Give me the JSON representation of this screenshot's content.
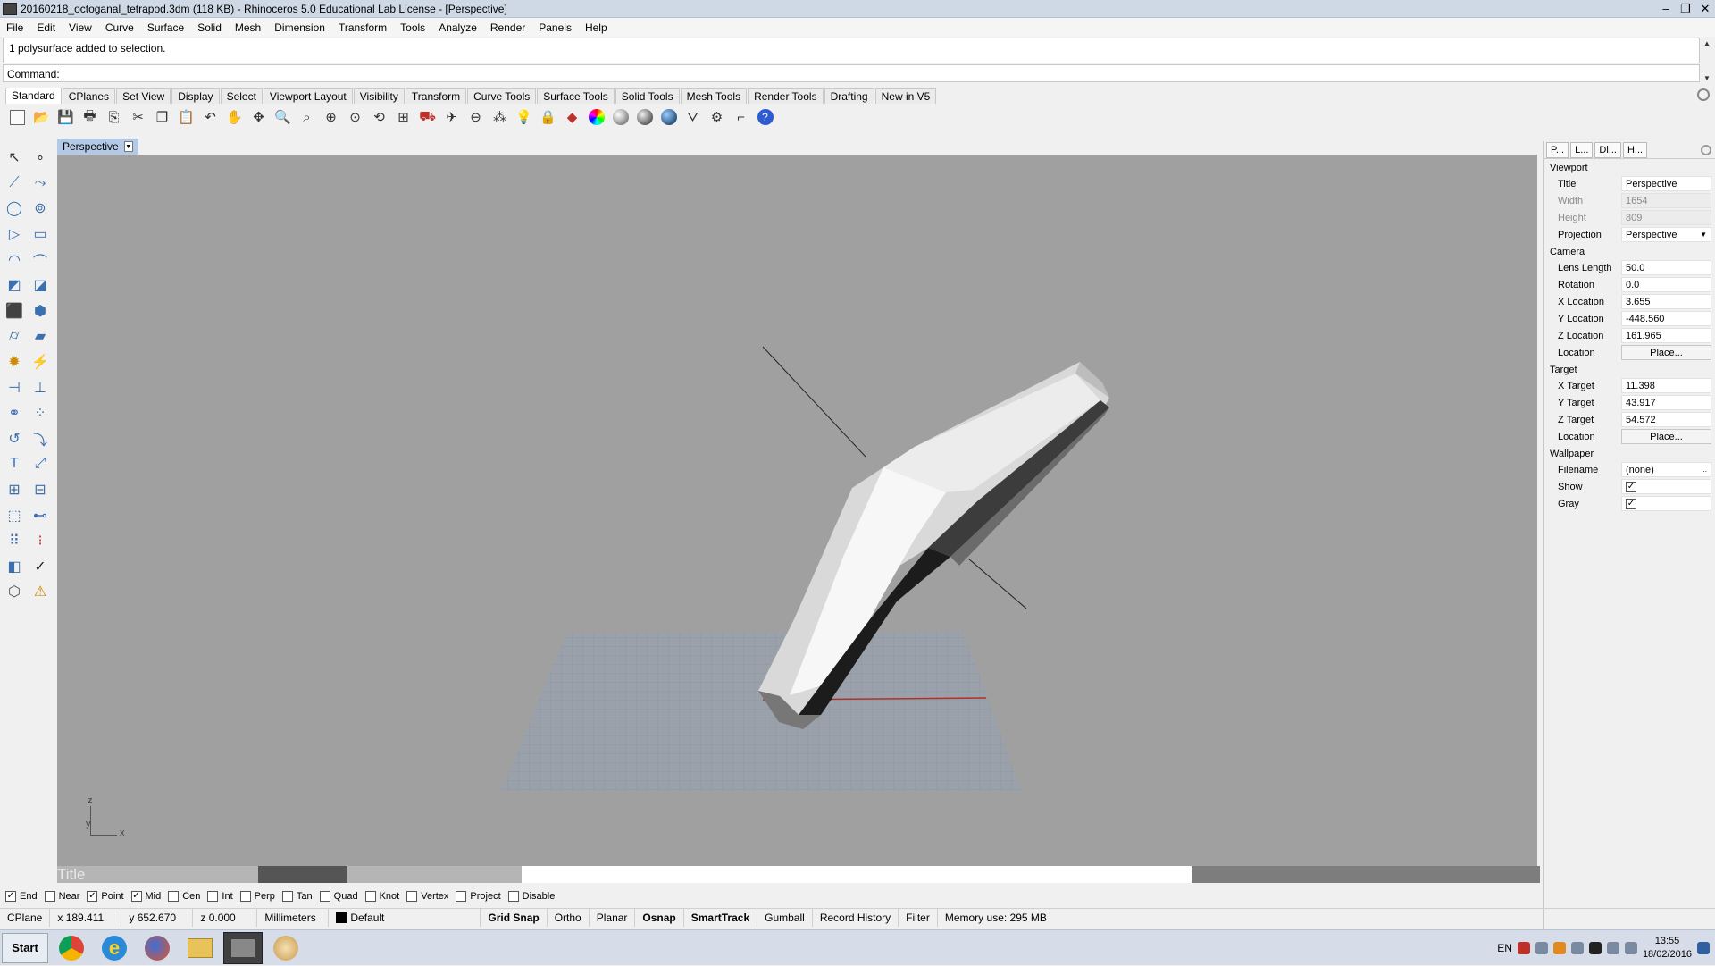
{
  "window": {
    "title": "20160218_octoganal_tetrapod.3dm (118 KB) - Rhinoceros 5.0 Educational Lab License - [Perspective]",
    "controls": [
      "–",
      "❐",
      "✕"
    ]
  },
  "menu": [
    "File",
    "Edit",
    "View",
    "Curve",
    "Surface",
    "Solid",
    "Mesh",
    "Dimension",
    "Transform",
    "Tools",
    "Analyze",
    "Render",
    "Panels",
    "Help"
  ],
  "command": {
    "history": "1 polysurface added to selection.",
    "prompt": "Command:"
  },
  "toolbar_tabs": [
    "Standard",
    "CPlanes",
    "Set View",
    "Display",
    "Select",
    "Viewport Layout",
    "Visibility",
    "Transform",
    "Curve Tools",
    "Surface Tools",
    "Solid Tools",
    "Mesh Tools",
    "Render Tools",
    "Drafting",
    "New in V5"
  ],
  "viewport": {
    "name": "Perspective",
    "axis_z": "z",
    "axis_y": "y",
    "axis_x": "x",
    "bottom_label": "Title"
  },
  "properties": {
    "tabs": [
      "P...",
      "L...",
      "Di...",
      "H..."
    ],
    "sections": {
      "viewport": "Viewport",
      "camera": "Camera",
      "target": "Target",
      "wallpaper": "Wallpaper"
    },
    "viewport_rows": {
      "title_k": "Title",
      "title_v": "Perspective",
      "width_k": "Width",
      "width_v": "1654",
      "height_k": "Height",
      "height_v": "809",
      "projection_k": "Projection",
      "projection_v": "Perspective"
    },
    "camera_rows": {
      "lens_k": "Lens Length",
      "lens_v": "50.0",
      "rot_k": "Rotation",
      "rot_v": "0.0",
      "xloc_k": "X Location",
      "xloc_v": "3.655",
      "yloc_k": "Y Location",
      "yloc_v": "-448.560",
      "zloc_k": "Z Location",
      "zloc_v": "161.965",
      "loc_k": "Location",
      "loc_v": "Place..."
    },
    "target_rows": {
      "xt_k": "X Target",
      "xt_v": "11.398",
      "yt_k": "Y Target",
      "yt_v": "43.917",
      "zt_k": "Z Target",
      "zt_v": "54.572",
      "loc_k": "Location",
      "loc_v": "Place..."
    },
    "wallpaper_rows": {
      "file_k": "Filename",
      "file_v": "(none)",
      "file_btn": "...",
      "show_k": "Show",
      "gray_k": "Gray"
    }
  },
  "osnap": {
    "end": "End",
    "near": "Near",
    "point": "Point",
    "mid": "Mid",
    "cen": "Cen",
    "int": "Int",
    "perp": "Perp",
    "tan": "Tan",
    "quad": "Quad",
    "knot": "Knot",
    "vertex": "Vertex",
    "project": "Project",
    "disable": "Disable"
  },
  "status": {
    "cplane": "CPlane",
    "x": "x 189.411",
    "y": "y 652.670",
    "z": "z 0.000",
    "units": "Millimeters",
    "layer": "Default",
    "grid_snap": "Grid Snap",
    "ortho": "Ortho",
    "planar": "Planar",
    "osnap": "Osnap",
    "smarttrack": "SmartTrack",
    "gumball": "Gumball",
    "record": "Record History",
    "filter": "Filter",
    "memory": "Memory use: 295 MB"
  },
  "taskbar": {
    "start": "Start",
    "lang": "EN",
    "time": "13:55",
    "date": "18/02/2016"
  }
}
